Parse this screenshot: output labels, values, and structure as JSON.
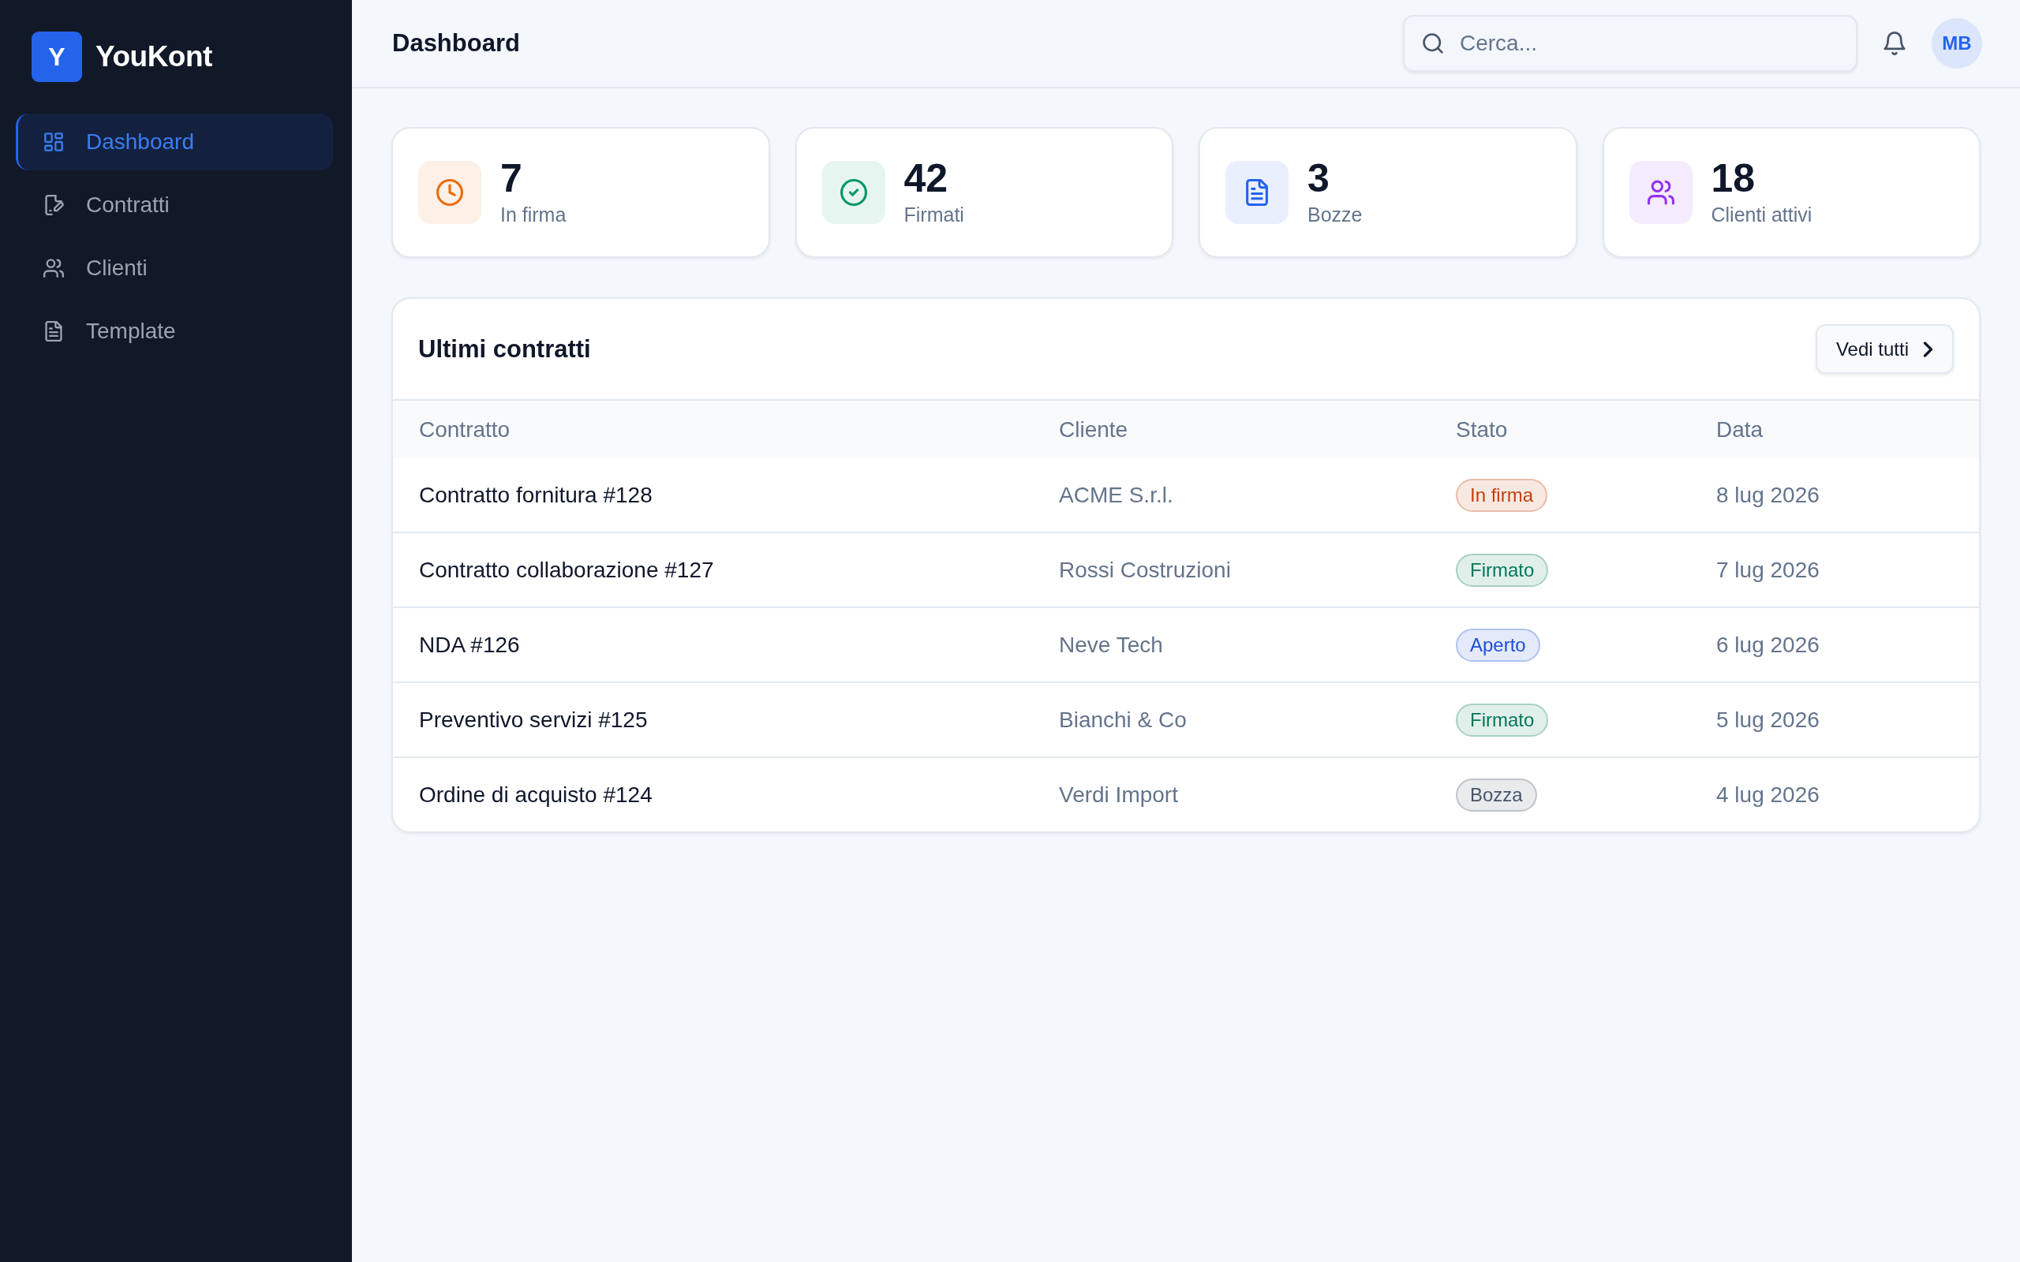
{
  "sidebar": {
    "logo": "Y",
    "app_name": "YouKont",
    "items": [
      {
        "label": "Dashboard",
        "kind": "dashboard",
        "selected": true
      },
      {
        "label": "Contratti",
        "kind": "contracts",
        "selected": false
      },
      {
        "label": "Clienti",
        "kind": "clients",
        "selected": false
      },
      {
        "label": "Template",
        "kind": "templates",
        "selected": false
      }
    ]
  },
  "topbar": {
    "title": "Dashboard",
    "search": {
      "placeholder": "Cerca..."
    },
    "avatar": "MB"
  },
  "stats": [
    {
      "value": "7",
      "label": "In firma",
      "kind": "pending",
      "color": "#ea6c0a"
    },
    {
      "value": "42",
      "label": "Firmati",
      "kind": "signed",
      "color": "#059669"
    },
    {
      "value": "3",
      "label": "Bozze",
      "kind": "drafts",
      "color": "#2563eb"
    },
    {
      "value": "18",
      "label": "Clienti attivi",
      "kind": "clients",
      "color": "#9333ea"
    }
  ],
  "contracts": {
    "title": "Ultimi contratti",
    "action": "Vedi tutti",
    "columns": [
      "Contratto",
      "Cliente",
      "Stato",
      "Data"
    ],
    "rows": [
      {
        "contract": "Contratto fornitura #128",
        "client": "ACME S.r.l.",
        "status": {
          "label": "In firma",
          "color": "#c2410c"
        },
        "date": "8 lug 2026"
      },
      {
        "contract": "Contratto collaborazione #127",
        "client": "Rossi Costruzioni",
        "status": {
          "label": "Firmato",
          "color": "#047857"
        },
        "date": "7 lug 2026"
      },
      {
        "contract": "NDA #126",
        "client": "Neve Tech",
        "status": {
          "label": "Aperto",
          "color": "#1d4ed8"
        },
        "date": "6 lug 2026"
      },
      {
        "contract": "Preventivo servizi #125",
        "client": "Bianchi & Co",
        "status": {
          "label": "Firmato",
          "color": "#047857"
        },
        "date": "5 lug 2026"
      },
      {
        "contract": "Ordine di acquisto #124",
        "client": "Verdi Import",
        "status": {
          "label": "Bozza",
          "color": "#475569"
        },
        "date": "4 lug 2026"
      }
    ]
  }
}
